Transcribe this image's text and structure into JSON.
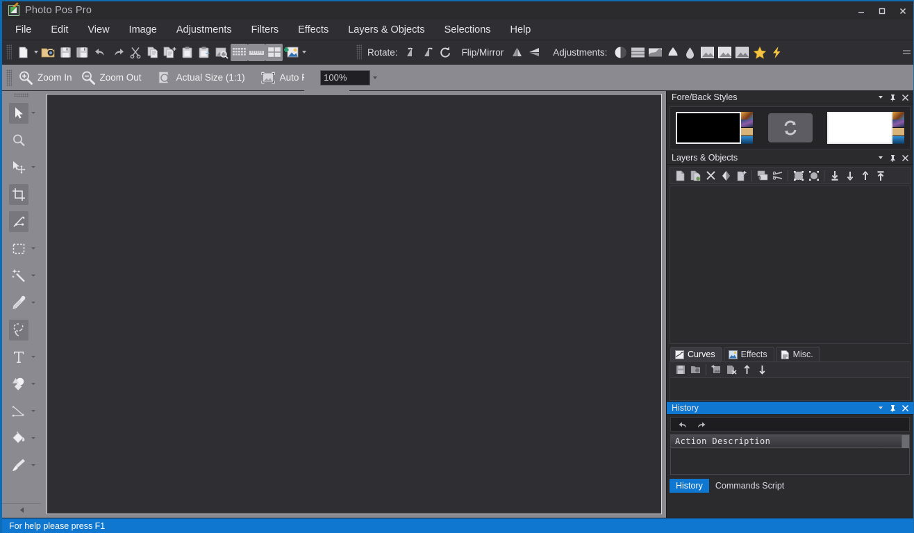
{
  "window": {
    "title": "Photo Pos Pro",
    "app_icon": "app-logo-icon",
    "controls": {
      "minimize": "—",
      "maximize": "▭",
      "close": "✕"
    }
  },
  "menubar": {
    "items": [
      {
        "label": "File"
      },
      {
        "label": "Edit"
      },
      {
        "label": "View"
      },
      {
        "label": "Image"
      },
      {
        "label": "Adjustments"
      },
      {
        "label": "Filters"
      },
      {
        "label": "Effects"
      },
      {
        "label": "Layers & Objects"
      },
      {
        "label": "Selections"
      },
      {
        "label": "Help"
      }
    ]
  },
  "toolbar": {
    "file_group": [
      {
        "name": "new-file-icon",
        "label": "New"
      },
      {
        "name": "new-file-dropdown-caret",
        "label": "New options"
      },
      {
        "name": "open-file-icon",
        "label": "Open"
      },
      {
        "name": "save-icon",
        "label": "Save"
      },
      {
        "name": "save-as-icon",
        "label": "Save As"
      },
      {
        "name": "undo-icon",
        "label": "Undo"
      },
      {
        "name": "redo-icon",
        "label": "Redo"
      },
      {
        "name": "cut-scissors-icon",
        "label": "Cut"
      },
      {
        "name": "copy-icon",
        "label": "Copy"
      },
      {
        "name": "copy-merged-icon",
        "label": "Copy Merged"
      },
      {
        "name": "paste-icon",
        "label": "Paste"
      },
      {
        "name": "paste-into-icon",
        "label": "Paste Into"
      },
      {
        "name": "preview-image-icon",
        "label": "Preview"
      }
    ],
    "view_group": [
      {
        "name": "grid-view-icon",
        "label": "Grid View",
        "active": true
      },
      {
        "name": "ruler-view-icon",
        "label": "Rulers",
        "active": true
      },
      {
        "name": "panes-view-icon",
        "label": "Panes",
        "active": true
      },
      {
        "name": "add-image-icon",
        "label": "Add Image",
        "active": false
      },
      {
        "name": "view-dropdown-caret",
        "label": "More view options"
      }
    ],
    "rotate_label": "Rotate:",
    "rotate_group": [
      {
        "name": "rotate-left-icon",
        "label": "Rotate Left"
      },
      {
        "name": "rotate-right-icon",
        "label": "Rotate Right"
      },
      {
        "name": "rotate-free-icon",
        "label": "Free Rotate"
      }
    ],
    "flip_label": "Flip/Mirror",
    "flip_group": [
      {
        "name": "flip-horizontal-icon",
        "label": "Flip Horizontal"
      },
      {
        "name": "flip-vertical-icon",
        "label": "Flip Vertical"
      }
    ],
    "adjustments_label": "Adjustments:",
    "adjustments_group": [
      {
        "name": "brightness-contrast-icon",
        "label": "Brightness/Contrast"
      },
      {
        "name": "levels-icon",
        "label": "Levels"
      },
      {
        "name": "curves-icon",
        "label": "Curves"
      },
      {
        "name": "color-balance-icon",
        "label": "Color Balance"
      },
      {
        "name": "hue-saturation-icon",
        "label": "Hue/Saturation"
      },
      {
        "name": "auto-contrast-icon",
        "label": "Auto Contrast"
      },
      {
        "name": "auto-levels-icon",
        "label": "Auto Levels"
      },
      {
        "name": "auto-color-icon",
        "label": "Auto Color"
      },
      {
        "name": "enhance-star-icon",
        "label": "Enhance"
      },
      {
        "name": "quick-fix-lightning-icon",
        "label": "Quick Fix"
      }
    ]
  },
  "zoombar": {
    "buttons": [
      {
        "name": "zoom-in-icon",
        "label": "Zoom In"
      },
      {
        "name": "zoom-out-icon",
        "label": "Zoom Out"
      },
      {
        "name": "actual-size-icon",
        "label": "Actual Size (1:1)"
      },
      {
        "name": "auto-fit-icon",
        "label": "Auto Fit"
      }
    ],
    "zoom_value": "100%",
    "zoom_placeholder": "100%"
  },
  "tools": {
    "items": [
      {
        "name": "select-arrow-tool",
        "label": "Select / Move Pointer",
        "selected": true,
        "caret": true
      },
      {
        "name": "magnifier-tool",
        "label": "Zoom Tool",
        "selected": false,
        "caret": false
      },
      {
        "name": "move-tool",
        "label": "Move",
        "selected": false,
        "caret": true
      },
      {
        "name": "crop-tool",
        "label": "Crop",
        "selected": true,
        "caret": false
      },
      {
        "name": "measure-tool",
        "label": "Measure",
        "selected": true,
        "caret": false
      },
      {
        "name": "rectangle-select-tool",
        "label": "Rectangular Selection",
        "selected": false,
        "caret": true
      },
      {
        "name": "magic-wand-tool",
        "label": "Magic Wand",
        "selected": false,
        "caret": true
      },
      {
        "name": "eyedropper-tool",
        "label": "Color Picker",
        "selected": false,
        "caret": true
      },
      {
        "name": "lasso-tool",
        "label": "Lasso Selection",
        "selected": true,
        "caret": false
      },
      {
        "name": "text-tool",
        "label": "Text",
        "selected": false,
        "caret": true
      },
      {
        "name": "shapes-tool",
        "label": "Shapes",
        "selected": false,
        "caret": true
      },
      {
        "name": "line-tool",
        "label": "Line / Vector",
        "selected": false,
        "caret": true
      },
      {
        "name": "paint-bucket-tool",
        "label": "Paint Bucket",
        "selected": false,
        "caret": true
      },
      {
        "name": "paintbrush-tool",
        "label": "Paint Brush",
        "selected": false,
        "caret": true
      }
    ],
    "scroll_label": "More tools"
  },
  "panels": {
    "fore_back": {
      "title": "Fore/Back Styles",
      "active": false,
      "foreground_color": "#000000",
      "background_color": "#ffffff",
      "swap_label": "Swap Colors",
      "header_buttons": [
        {
          "name": "panel-menu-caret-icon",
          "label": "Panel Menu"
        },
        {
          "name": "panel-pin-icon",
          "label": "Pin Panel"
        },
        {
          "name": "panel-close-icon",
          "label": "Close Panel"
        }
      ]
    },
    "layers": {
      "title": "Layers & Objects",
      "active": false,
      "header_buttons": [
        {
          "name": "panel-menu-caret-icon",
          "label": "Panel Menu"
        },
        {
          "name": "panel-pin-icon",
          "label": "Pin Panel"
        },
        {
          "name": "panel-close-icon",
          "label": "Close Panel"
        }
      ],
      "toolbar": [
        {
          "name": "new-layer-icon",
          "label": "New Layer"
        },
        {
          "name": "duplicate-layer-icon",
          "label": "Duplicate Layer"
        },
        {
          "name": "delete-layer-icon",
          "label": "Delete Layer"
        },
        {
          "name": "layer-mask-icon",
          "label": "Layer Mask"
        },
        {
          "name": "new-layer-from-icon",
          "label": "New Layer From Selection"
        },
        {
          "name": "merge-layers-icon",
          "label": "Merge Layers"
        },
        {
          "name": "flatten-layers-icon",
          "label": "Flatten Image"
        },
        {
          "name": "group-objects-icon",
          "label": "Group Objects"
        },
        {
          "name": "ungroup-objects-icon",
          "label": "Ungroup Objects"
        },
        {
          "name": "send-to-back-icon",
          "label": "Send to Back"
        },
        {
          "name": "move-down-icon",
          "label": "Move Down"
        },
        {
          "name": "move-up-icon",
          "label": "Move Up"
        },
        {
          "name": "bring-to-front-icon",
          "label": "Bring to Front"
        }
      ],
      "layer_list_items": [],
      "tabs": [
        {
          "name": "tab-curves",
          "label": "Curves",
          "icon": "curves-tab-icon",
          "active": true
        },
        {
          "name": "tab-effects",
          "label": "Effects",
          "icon": "effects-tab-icon",
          "active": false
        },
        {
          "name": "tab-misc",
          "label": "Misc.",
          "icon": "misc-tab-icon",
          "active": false
        }
      ],
      "sub_toolbar": [
        {
          "name": "save-curve-icon",
          "label": "Save Curve"
        },
        {
          "name": "load-curve-icon",
          "label": "Load Curve"
        },
        {
          "name": "add-curve-icon",
          "label": "Add Curve"
        },
        {
          "name": "remove-curve-icon",
          "label": "Remove Curve"
        },
        {
          "name": "curve-up-icon",
          "label": "Move Up"
        },
        {
          "name": "curve-down-icon",
          "label": "Move Down"
        }
      ]
    },
    "history": {
      "title": "History",
      "active": true,
      "header_buttons": [
        {
          "name": "panel-menu-caret-icon",
          "label": "Panel Menu"
        },
        {
          "name": "panel-pin-icon",
          "label": "Pin Panel"
        },
        {
          "name": "panel-close-icon",
          "label": "Close Panel"
        }
      ],
      "toolbar": [
        {
          "name": "history-undo-icon",
          "label": "Undo"
        },
        {
          "name": "history-redo-icon",
          "label": "Redo"
        }
      ],
      "column_header": "Action Description",
      "rows": [],
      "bottom_tabs": [
        {
          "name": "bottom-tab-history",
          "label": "History",
          "active": true
        },
        {
          "name": "bottom-tab-commands-script",
          "label": "Commands Script",
          "active": false
        }
      ]
    }
  },
  "statusbar": {
    "text": "For help please press F1"
  },
  "colors": {
    "accent": "#0f77cf",
    "panel_bg": "#2b2b2e",
    "toolbar_bg": "#2f2f33",
    "palette_bg": "#8a8a90",
    "canvas_bg": "#2e2e33",
    "text": "#e2e2e6"
  }
}
